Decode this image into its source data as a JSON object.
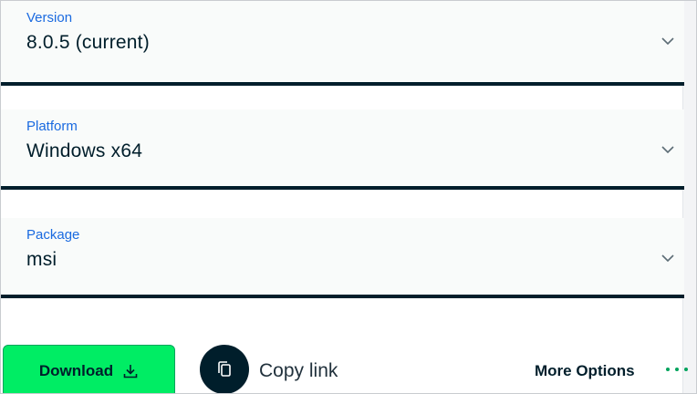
{
  "version": {
    "label": "Version",
    "value": "8.0.5 (current)",
    "icon": "chevron-down-icon"
  },
  "platform": {
    "label": "Platform",
    "value": "Windows x64",
    "icon": "chevron-down-icon"
  },
  "package": {
    "label": "Package",
    "value": "msi",
    "icon": "chevron-down-icon"
  },
  "actions": {
    "download_label": "Download",
    "download_icon": "download-icon",
    "copy_link_label": "Copy link",
    "copy_icon": "copy-icon",
    "more_options_label": "More Options",
    "more_icon": "more-dots-icon"
  },
  "colors": {
    "accent_green": "#00ed64",
    "label_blue": "#1a6ae0",
    "divider_navy": "#001e2b",
    "dot_green": "#00a35c"
  }
}
